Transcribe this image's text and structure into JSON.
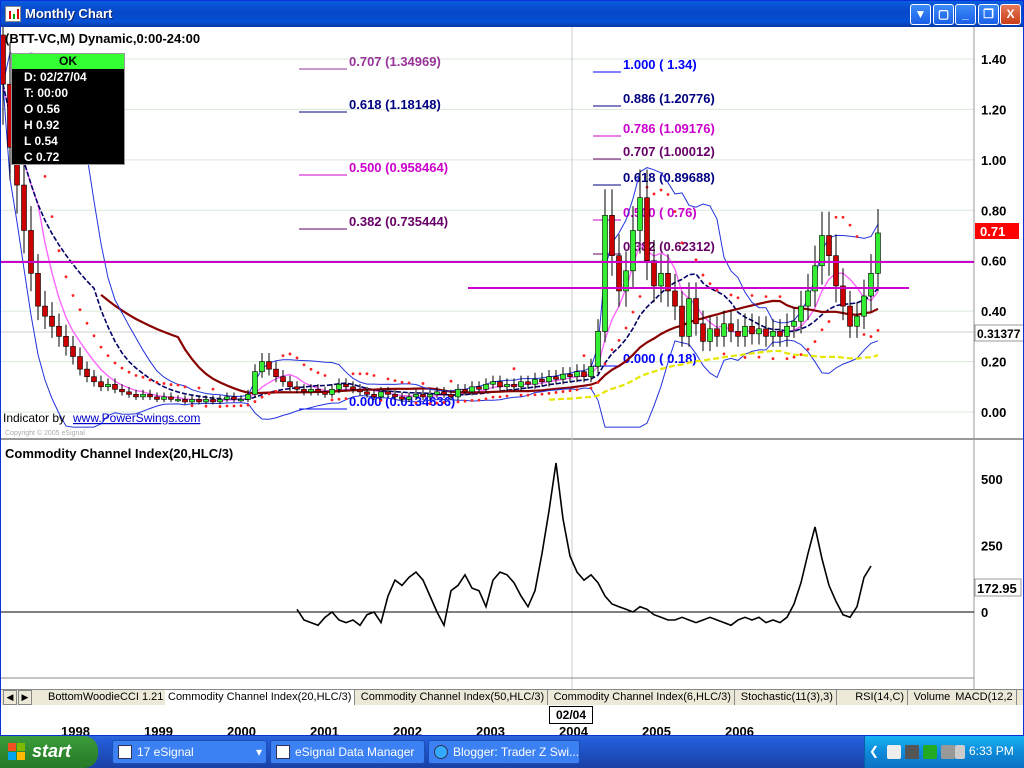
{
  "window": {
    "title": "Monthly Chart",
    "buttons": {
      "scroll": "▼",
      "restore1": "▢",
      "minimize": "_",
      "restore": "❐",
      "close": "X"
    }
  },
  "price_pane": {
    "symbol_title": "(BTT-VC,M) Dynamic,0:00-24:00",
    "indicator_credit": "Indicator by",
    "indicator_link": "www.PowerSwings.com",
    "copyright": "Copyright © 2005 eSignal",
    "ohlc_box": {
      "header": "OK",
      "date": "D: 02/27/04",
      "time": "T: 00:00",
      "open": "O  0.56",
      "high": "H  0.92",
      "low": "L  0.54",
      "close": "C  0.72"
    },
    "y_ticks": [
      "1.40",
      "1.20",
      "1.00",
      "0.80",
      "0.60",
      "0.40",
      "0.20",
      "0.00"
    ],
    "last_price": "0.71",
    "crosshair_price": "0.31377",
    "fib_left": [
      {
        "label": "0.707 (1.34969)",
        "color": "#993399"
      },
      {
        "label": "0.618 (1.18148)",
        "color": "#000080"
      },
      {
        "label": "0.500 (0.958464)",
        "color": "#cc00cc"
      },
      {
        "label": "0.382 (0.735444)",
        "color": "#660066"
      },
      {
        "label": "0.000 (0.0134636)",
        "color": "#0000ff"
      }
    ],
    "fib_right": [
      {
        "label": "1.000 ( 1.34)",
        "color": "#0000ff"
      },
      {
        "label": "0.886 (1.20776)",
        "color": "#000080"
      },
      {
        "label": "0.786 (1.09176)",
        "color": "#cc00cc"
      },
      {
        "label": "0.707 (1.00012)",
        "color": "#660066"
      },
      {
        "label": "0.618 (0.89688)",
        "color": "#000080"
      },
      {
        "label": "0.500 ( 0.76)",
        "color": "#cc00cc"
      },
      {
        "label": "0.382 (0.62312)",
        "color": "#660066"
      },
      {
        "label": "0.000 ( 0.18)",
        "color": "#0000ff"
      }
    ]
  },
  "cci_pane": {
    "title": "Commodity Channel Index(20,HLC/3)",
    "y_ticks": [
      "500",
      "250",
      "0"
    ],
    "last_value": "172.95"
  },
  "tabs": [
    "BottomWoodieCCI 1.21",
    "Commodity Channel Index(20,HLC/3)",
    "Commodity Channel Index(50,HLC/3)",
    "Commodity Channel Index(6,HLC/3)",
    "Stochastic(11(3),3)",
    "RSI(14,C)",
    "Volume",
    "MACD(12,2"
  ],
  "active_tab": "Commodity Channel Index(20,HLC/3)",
  "x_axis": {
    "years": [
      "1998",
      "1999",
      "2000",
      "2001",
      "2002",
      "2003",
      "2004",
      "2005",
      "2006"
    ],
    "cursor_date": "02/04"
  },
  "chart_data": [
    {
      "type": "candlestick",
      "title": "(BTT-VC,M) Dynamic,0:00-24:00",
      "ylim": [
        -0.05,
        1.5
      ],
      "x_range": [
        "1997-07",
        "2006-12"
      ],
      "close_series": {
        "start": "1997-07",
        "values": [
          1.3,
          1.05,
          0.9,
          0.72,
          0.55,
          0.42,
          0.38,
          0.34,
          0.3,
          0.26,
          0.22,
          0.17,
          0.14,
          0.12,
          0.1,
          0.11,
          0.09,
          0.08,
          0.07,
          0.06,
          0.07,
          0.06,
          0.05,
          0.06,
          0.05,
          0.05,
          0.04,
          0.05,
          0.04,
          0.05,
          0.04,
          0.05,
          0.06,
          0.05,
          0.05,
          0.07,
          0.16,
          0.2,
          0.17,
          0.14,
          0.12,
          0.1,
          0.09,
          0.08,
          0.09,
          0.08,
          0.07,
          0.09,
          0.11,
          0.1,
          0.09,
          0.08,
          0.07,
          0.06,
          0.08,
          0.07,
          0.06,
          0.05,
          0.06,
          0.07,
          0.06,
          0.07,
          0.08,
          0.07,
          0.06,
          0.09,
          0.08,
          0.1,
          0.09,
          0.11,
          0.12,
          0.1,
          0.11,
          0.1,
          0.12,
          0.11,
          0.13,
          0.12,
          0.14,
          0.13,
          0.15,
          0.14,
          0.16,
          0.14,
          0.18,
          0.32,
          0.78,
          0.62,
          0.48,
          0.56,
          0.72,
          0.85,
          0.6,
          0.5,
          0.55,
          0.48,
          0.42,
          0.3,
          0.45,
          0.35,
          0.28,
          0.33,
          0.3,
          0.35,
          0.32,
          0.3,
          0.34,
          0.31,
          0.33,
          0.3,
          0.32,
          0.3,
          0.34,
          0.36,
          0.42,
          0.48,
          0.58,
          0.7,
          0.62,
          0.5,
          0.42,
          0.34,
          0.38,
          0.46,
          0.55,
          0.71
        ]
      },
      "last_close": 0.71,
      "last_bar": {
        "date": "02/27/04",
        "open": 0.56,
        "high": 0.92,
        "low": 0.54,
        "close": 0.72
      }
    },
    {
      "type": "line",
      "title": "Commodity Channel Index(20,HLC/3)",
      "ylim": [
        -50,
        600
      ],
      "series": [
        {
          "name": "Commodity Channel Index(20,HLC/3)",
          "x_start": "2001-01",
          "values": [
            10,
            -30,
            -40,
            -50,
            -20,
            0,
            -30,
            -40,
            -30,
            -50,
            -10,
            0,
            -40,
            60,
            120,
            100,
            130,
            150,
            120,
            60,
            0,
            -50,
            80,
            100,
            140,
            90,
            80,
            20,
            120,
            150,
            140,
            110,
            60,
            20,
            80,
            220,
            380,
            560,
            350,
            210,
            150,
            120,
            140,
            110,
            60,
            30,
            20,
            10,
            0,
            20,
            10,
            -10,
            -20,
            -30,
            -30,
            -20,
            -30,
            -40,
            -30,
            -20,
            -30,
            -40,
            -50,
            -30,
            -20,
            -30,
            -20,
            -40,
            -30,
            -40,
            -20,
            30,
            110,
            220,
            320,
            200,
            100,
            40,
            -10,
            -20,
            20,
            130,
            172.95
          ]
        }
      ],
      "last_value": 172.95,
      "y_ticks": [
        500,
        250,
        0
      ]
    }
  ],
  "taskbar": {
    "start": "start",
    "tasks": [
      "17 eSignal",
      "eSignal Data Manager",
      "Blogger: Trader Z Swi..."
    ],
    "clock": "6:33 PM"
  }
}
